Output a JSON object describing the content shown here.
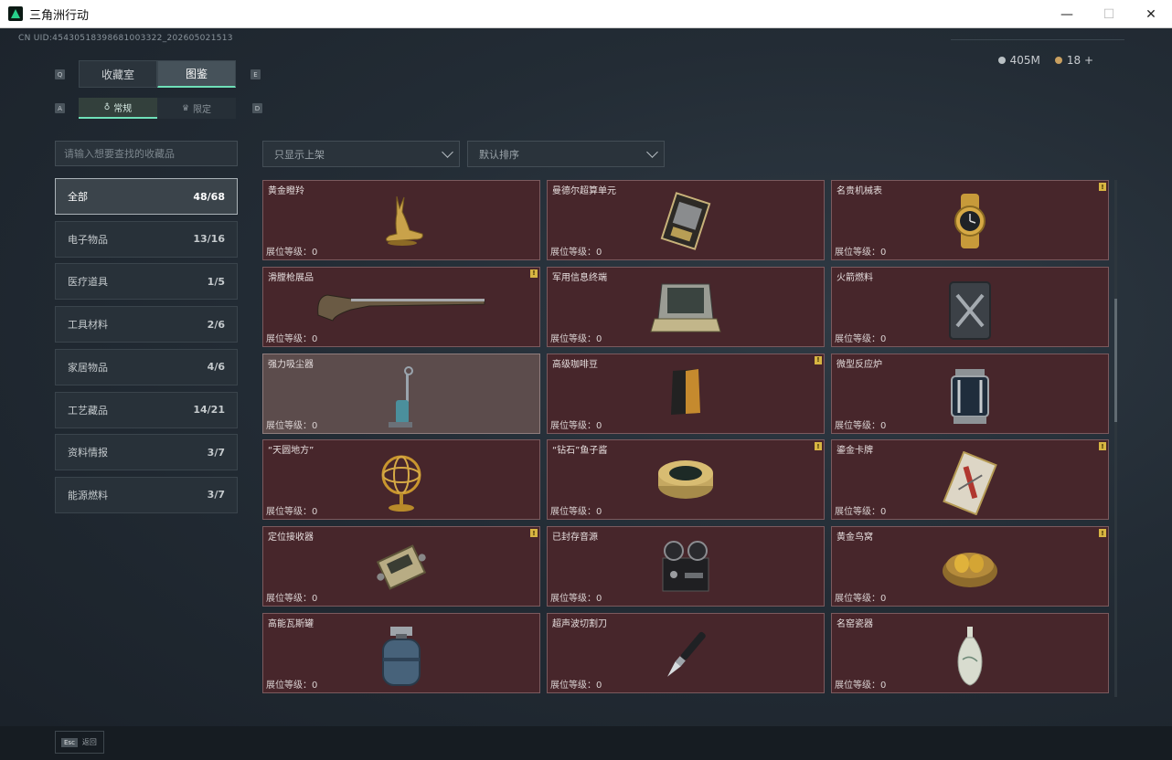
{
  "window": {
    "title": "三角洲行动",
    "buttons": [
      "—",
      "☐",
      "✕"
    ]
  },
  "uid": "CN UID:45430518398681003322_202605021513",
  "currency": [
    {
      "value": "405M",
      "color": "#b9c0c4"
    },
    {
      "value": "18 +",
      "color": "#c9a060"
    }
  ],
  "keys": {
    "tab_prev": "Q",
    "tab_next": "E",
    "sub_prev": "A",
    "sub_next": "D"
  },
  "tabs": [
    {
      "label": "收藏室",
      "active": false
    },
    {
      "label": "图鉴",
      "active": true
    }
  ],
  "subtabs": [
    {
      "label": "常规",
      "icon": "♁",
      "active": true
    },
    {
      "label": "限定",
      "icon": "♛",
      "active": false
    }
  ],
  "search": {
    "placeholder": "请输入想要查找的收藏品"
  },
  "categories": [
    {
      "label": "全部",
      "count": "48/68",
      "active": true
    },
    {
      "label": "电子物品",
      "count": "13/16"
    },
    {
      "label": "医疗道具",
      "count": "1/5"
    },
    {
      "label": "工具材料",
      "count": "2/6"
    },
    {
      "label": "家居物品",
      "count": "4/6"
    },
    {
      "label": "工艺藏品",
      "count": "14/21"
    },
    {
      "label": "资料情报",
      "count": "3/7"
    },
    {
      "label": "能源燃料",
      "count": "3/7"
    }
  ],
  "filters": {
    "shelf": "只显示上架",
    "sort": "默认排序"
  },
  "items": [
    {
      "name": "黄金瞪羚",
      "level": "展位等级：0",
      "badge": false,
      "icon": "gazelle-icon"
    },
    {
      "name": "曼德尔超算单元",
      "level": "展位等级：0",
      "badge": false,
      "icon": "supercomputer-icon"
    },
    {
      "name": "名贵机械表",
      "level": "展位等级：0",
      "badge": true,
      "icon": "watch-icon"
    },
    {
      "name": "滑膛枪展品",
      "level": "展位等级：0",
      "badge": true,
      "icon": "musket-icon"
    },
    {
      "name": "军用信息终端",
      "level": "展位等级：0",
      "badge": false,
      "icon": "terminal-icon"
    },
    {
      "name": "火箭燃料",
      "level": "展位等级：0",
      "badge": false,
      "icon": "fuel-can-icon"
    },
    {
      "name": "强力吸尘器",
      "level": "展位等级：0",
      "badge": false,
      "icon": "vacuum-icon",
      "highlight": true
    },
    {
      "name": "高级咖啡豆",
      "level": "展位等级：0",
      "badge": true,
      "icon": "coffee-bag-icon"
    },
    {
      "name": "微型反应炉",
      "level": "展位等级：0",
      "badge": false,
      "icon": "reactor-icon"
    },
    {
      "name": "“天圆地方”",
      "level": "展位等级：0",
      "badge": false,
      "icon": "armillary-icon"
    },
    {
      "name": "“钻石”鱼子酱",
      "level": "展位等级：0",
      "badge": true,
      "icon": "caviar-tin-icon"
    },
    {
      "name": "鎏金卡牌",
      "level": "展位等级：0",
      "badge": true,
      "icon": "card-icon"
    },
    {
      "name": "定位接收器",
      "level": "展位等级：0",
      "badge": true,
      "icon": "receiver-icon"
    },
    {
      "name": "已封存音源",
      "level": "展位等级：0",
      "badge": false,
      "icon": "tape-recorder-icon"
    },
    {
      "name": "黄金鸟窝",
      "level": "展位等级：0",
      "badge": true,
      "icon": "nest-icon"
    },
    {
      "name": "高能瓦斯罐",
      "level": "展位等级：0",
      "badge": false,
      "icon": "gas-tank-icon"
    },
    {
      "name": "超声波切割刀",
      "level": "展位等级：0",
      "badge": false,
      "icon": "cutter-icon"
    },
    {
      "name": "名窑瓷器",
      "level": "展位等级：0",
      "badge": false,
      "icon": "vase-icon"
    }
  ],
  "esc": {
    "key": "Esc",
    "label": "返回"
  }
}
